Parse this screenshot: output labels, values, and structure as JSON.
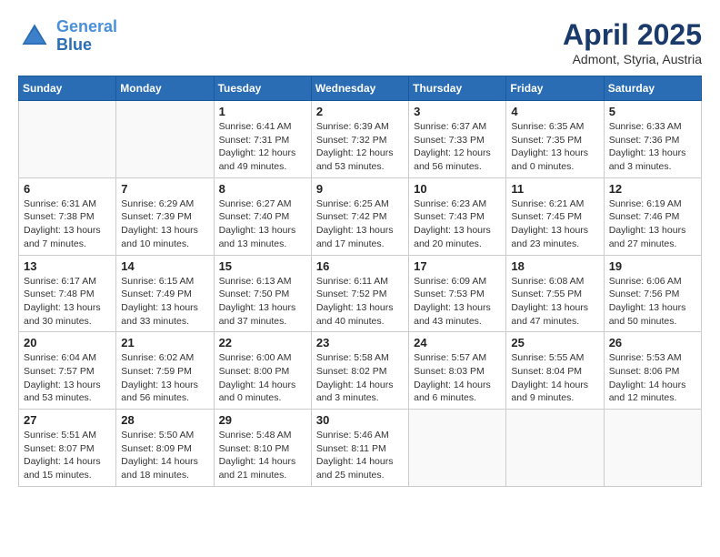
{
  "header": {
    "logo_line1": "General",
    "logo_line2": "Blue",
    "month": "April 2025",
    "location": "Admont, Styria, Austria"
  },
  "days_of_week": [
    "Sunday",
    "Monday",
    "Tuesday",
    "Wednesday",
    "Thursday",
    "Friday",
    "Saturday"
  ],
  "weeks": [
    [
      {
        "num": "",
        "info": ""
      },
      {
        "num": "",
        "info": ""
      },
      {
        "num": "1",
        "info": "Sunrise: 6:41 AM\nSunset: 7:31 PM\nDaylight: 12 hours\nand 49 minutes."
      },
      {
        "num": "2",
        "info": "Sunrise: 6:39 AM\nSunset: 7:32 PM\nDaylight: 12 hours\nand 53 minutes."
      },
      {
        "num": "3",
        "info": "Sunrise: 6:37 AM\nSunset: 7:33 PM\nDaylight: 12 hours\nand 56 minutes."
      },
      {
        "num": "4",
        "info": "Sunrise: 6:35 AM\nSunset: 7:35 PM\nDaylight: 13 hours\nand 0 minutes."
      },
      {
        "num": "5",
        "info": "Sunrise: 6:33 AM\nSunset: 7:36 PM\nDaylight: 13 hours\nand 3 minutes."
      }
    ],
    [
      {
        "num": "6",
        "info": "Sunrise: 6:31 AM\nSunset: 7:38 PM\nDaylight: 13 hours\nand 7 minutes."
      },
      {
        "num": "7",
        "info": "Sunrise: 6:29 AM\nSunset: 7:39 PM\nDaylight: 13 hours\nand 10 minutes."
      },
      {
        "num": "8",
        "info": "Sunrise: 6:27 AM\nSunset: 7:40 PM\nDaylight: 13 hours\nand 13 minutes."
      },
      {
        "num": "9",
        "info": "Sunrise: 6:25 AM\nSunset: 7:42 PM\nDaylight: 13 hours\nand 17 minutes."
      },
      {
        "num": "10",
        "info": "Sunrise: 6:23 AM\nSunset: 7:43 PM\nDaylight: 13 hours\nand 20 minutes."
      },
      {
        "num": "11",
        "info": "Sunrise: 6:21 AM\nSunset: 7:45 PM\nDaylight: 13 hours\nand 23 minutes."
      },
      {
        "num": "12",
        "info": "Sunrise: 6:19 AM\nSunset: 7:46 PM\nDaylight: 13 hours\nand 27 minutes."
      }
    ],
    [
      {
        "num": "13",
        "info": "Sunrise: 6:17 AM\nSunset: 7:48 PM\nDaylight: 13 hours\nand 30 minutes."
      },
      {
        "num": "14",
        "info": "Sunrise: 6:15 AM\nSunset: 7:49 PM\nDaylight: 13 hours\nand 33 minutes."
      },
      {
        "num": "15",
        "info": "Sunrise: 6:13 AM\nSunset: 7:50 PM\nDaylight: 13 hours\nand 37 minutes."
      },
      {
        "num": "16",
        "info": "Sunrise: 6:11 AM\nSunset: 7:52 PM\nDaylight: 13 hours\nand 40 minutes."
      },
      {
        "num": "17",
        "info": "Sunrise: 6:09 AM\nSunset: 7:53 PM\nDaylight: 13 hours\nand 43 minutes."
      },
      {
        "num": "18",
        "info": "Sunrise: 6:08 AM\nSunset: 7:55 PM\nDaylight: 13 hours\nand 47 minutes."
      },
      {
        "num": "19",
        "info": "Sunrise: 6:06 AM\nSunset: 7:56 PM\nDaylight: 13 hours\nand 50 minutes."
      }
    ],
    [
      {
        "num": "20",
        "info": "Sunrise: 6:04 AM\nSunset: 7:57 PM\nDaylight: 13 hours\nand 53 minutes."
      },
      {
        "num": "21",
        "info": "Sunrise: 6:02 AM\nSunset: 7:59 PM\nDaylight: 13 hours\nand 56 minutes."
      },
      {
        "num": "22",
        "info": "Sunrise: 6:00 AM\nSunset: 8:00 PM\nDaylight: 14 hours\nand 0 minutes."
      },
      {
        "num": "23",
        "info": "Sunrise: 5:58 AM\nSunset: 8:02 PM\nDaylight: 14 hours\nand 3 minutes."
      },
      {
        "num": "24",
        "info": "Sunrise: 5:57 AM\nSunset: 8:03 PM\nDaylight: 14 hours\nand 6 minutes."
      },
      {
        "num": "25",
        "info": "Sunrise: 5:55 AM\nSunset: 8:04 PM\nDaylight: 14 hours\nand 9 minutes."
      },
      {
        "num": "26",
        "info": "Sunrise: 5:53 AM\nSunset: 8:06 PM\nDaylight: 14 hours\nand 12 minutes."
      }
    ],
    [
      {
        "num": "27",
        "info": "Sunrise: 5:51 AM\nSunset: 8:07 PM\nDaylight: 14 hours\nand 15 minutes."
      },
      {
        "num": "28",
        "info": "Sunrise: 5:50 AM\nSunset: 8:09 PM\nDaylight: 14 hours\nand 18 minutes."
      },
      {
        "num": "29",
        "info": "Sunrise: 5:48 AM\nSunset: 8:10 PM\nDaylight: 14 hours\nand 21 minutes."
      },
      {
        "num": "30",
        "info": "Sunrise: 5:46 AM\nSunset: 8:11 PM\nDaylight: 14 hours\nand 25 minutes."
      },
      {
        "num": "",
        "info": ""
      },
      {
        "num": "",
        "info": ""
      },
      {
        "num": "",
        "info": ""
      }
    ]
  ]
}
